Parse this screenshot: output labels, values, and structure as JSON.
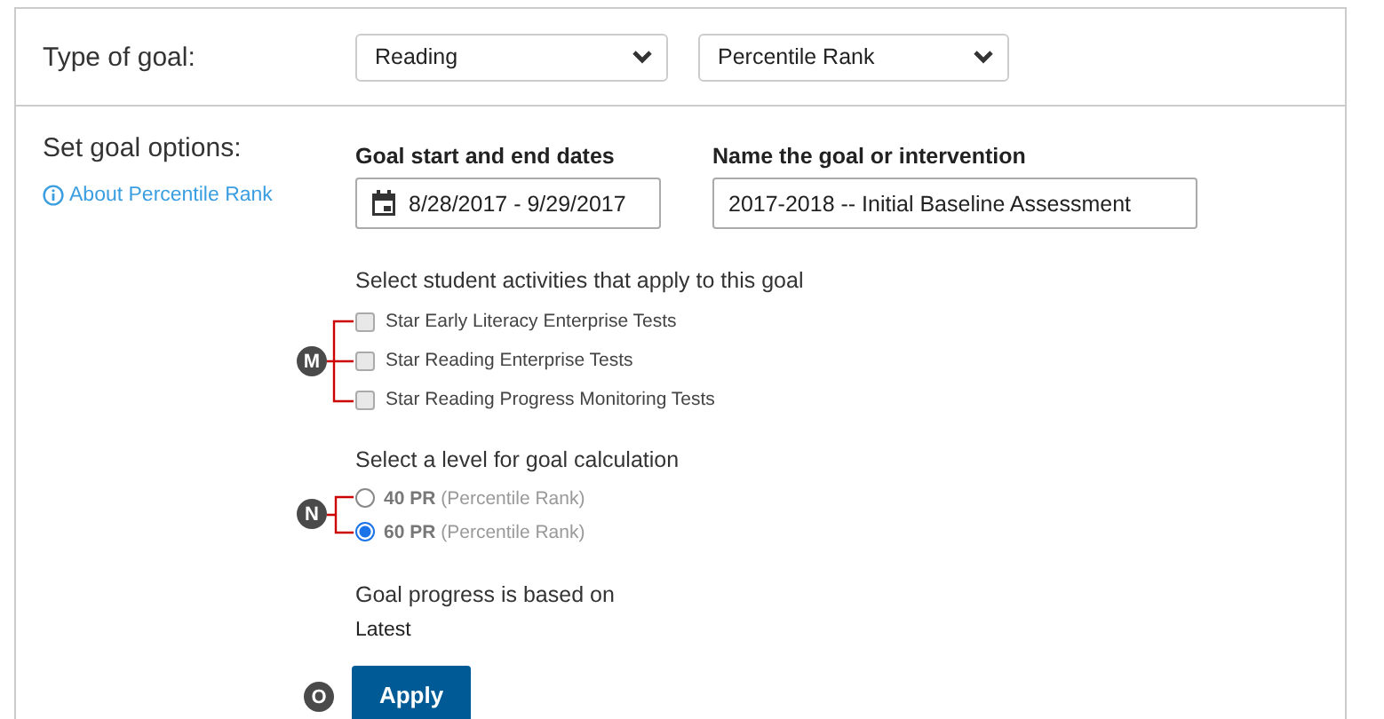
{
  "goal_type": {
    "label": "Type of goal:",
    "subject": {
      "value": "Reading"
    },
    "measure": {
      "value": "Percentile Rank"
    }
  },
  "options": {
    "label": "Set goal options:",
    "about_link": "About Percentile Rank",
    "dates": {
      "label": "Goal start and end dates",
      "value": "8/28/2017 - 9/29/2017"
    },
    "name": {
      "label": "Name the goal or intervention",
      "value": "2017-2018 -- Initial Baseline Assessment"
    },
    "activities": {
      "heading": "Select student activities that apply to this goal",
      "callout": "M",
      "items": [
        {
          "label": "Star Early Literacy Enterprise Tests",
          "checked": false
        },
        {
          "label": "Star Reading Enterprise Tests",
          "checked": false
        },
        {
          "label": "Star Reading Progress Monitoring Tests",
          "checked": false
        }
      ]
    },
    "levels": {
      "heading": "Select a level for goal calculation",
      "callout": "N",
      "items": [
        {
          "value": "40 PR",
          "note": "(Percentile Rank)",
          "selected": false
        },
        {
          "value": "60 PR",
          "note": "(Percentile Rank)",
          "selected": true
        }
      ]
    },
    "progress": {
      "heading": "Goal progress is based on",
      "value": "Latest"
    },
    "apply": {
      "label": "Apply",
      "callout": "O"
    }
  }
}
